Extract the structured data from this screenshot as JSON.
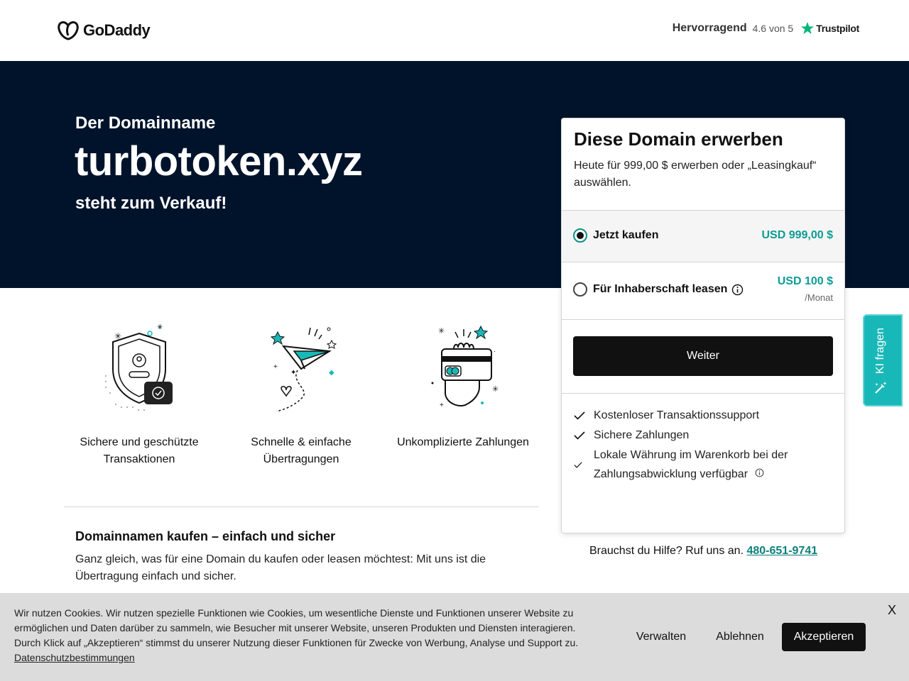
{
  "header": {
    "logo_text": "GoDaddy",
    "rating_word": "Hervorragend",
    "rating_score": "4.6 von 5",
    "trustpilot_label": "Trustpilot"
  },
  "hero": {
    "subtitle": "Der Domainname",
    "domain": "turbotoken.xyz",
    "for_sale": "steht zum Verkauf!"
  },
  "features": [
    {
      "label": "Sichere und geschützte Transaktionen",
      "icon": "shield-icon"
    },
    {
      "label": "Schnelle & einfache Übertragungen",
      "icon": "paper-plane-icon"
    },
    {
      "label": "Unkomplizierte Zahlungen",
      "icon": "card-payment-icon"
    }
  ],
  "info": {
    "title": "Domainnamen kaufen – einfach und sicher",
    "text": "Ganz gleich, was für eine Domain du kaufen oder leasen möchtest: Mit uns ist die Übertragung einfach und sicher."
  },
  "card": {
    "title": "Diese Domain erwerben",
    "description": "Heute für 999,00 $ erwerben oder „Leasingkauf“ auswählen.",
    "options": [
      {
        "label": "Jetzt kaufen",
        "price": "USD 999,00 $",
        "selected": true
      },
      {
        "label": "Für Inhaberschaft leasen",
        "price": "USD 100 $",
        "period": "/Monat",
        "selected": false
      }
    ],
    "button_label": "Weiter",
    "benefits": [
      "Kostenloser Transaktionssupport",
      "Sichere Zahlungen",
      "Lokale Währung im Warenkorb bei der Zahlungsabwicklung verfügbar"
    ]
  },
  "help": {
    "text": "Brauchst du Hilfe? Ruf uns an.",
    "phone": "480-651-9741"
  },
  "ki_tab": {
    "label": "KI fragen"
  },
  "cookie": {
    "text": "Wir nutzen Cookies. Wir nutzen spezielle Funktionen wie Cookies, um wesentliche Dienste und Funktionen unserer Website zu ermöglichen und Daten darüber zu sammeln, wie Besucher mit unserer Website, unseren Produkten und Diensten interagieren. Durch Klick auf „Akzeptieren“ stimmst du unserer Nutzung dieser Funktionen für Zwecke von Werbung, Analyse und Support zu.",
    "policy_link": "Datenschutzbestimmungen",
    "manage": "Verwalten",
    "decline": "Ablehnen",
    "accept": "Akzeptieren",
    "close": "X"
  },
  "colors": {
    "hero_bg": "#00132b",
    "accent_teal": "#0d9c95",
    "ki_tab": "#19b8b8",
    "trustpilot_green": "#00b67a"
  }
}
